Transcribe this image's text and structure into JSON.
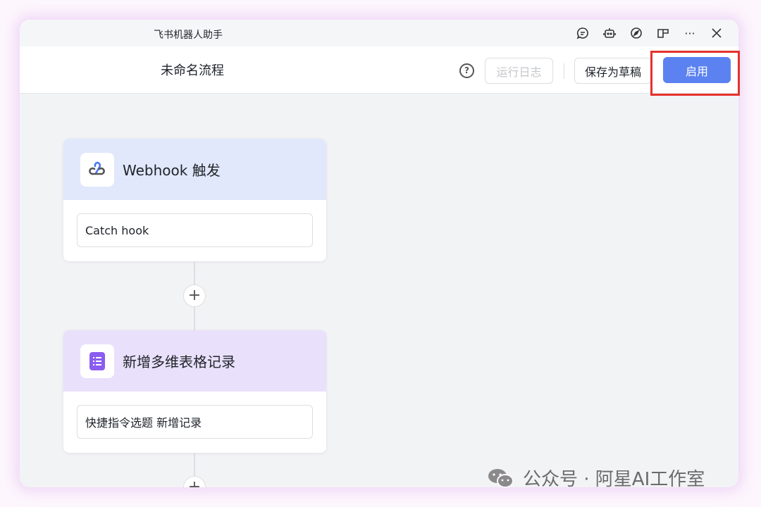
{
  "window": {
    "title": "飞书机器人助手",
    "icons": [
      "chat-icon",
      "robot-icon",
      "compass-icon",
      "layout-icon",
      "more-icon",
      "close-icon"
    ]
  },
  "header": {
    "flow_name": "未命名流程",
    "help": "?",
    "run_log": "运行日志",
    "save_draft": "保存为草稿",
    "enable": "启用"
  },
  "nodes": [
    {
      "title": "Webhook 触发",
      "icon": "webhook-icon",
      "field": "Catch hook",
      "header_color": "#e1e8fb"
    },
    {
      "title": "新增多维表格记录",
      "icon": "bitable-icon",
      "field": "快捷指令选题 新增记录",
      "header_color": "#e9e0fb"
    }
  ],
  "add_symbol": "+",
  "watermark": "公众号 · 阿星AI工作室",
  "colors": {
    "accent": "#5b82f0",
    "highlight": "#e5322d"
  }
}
